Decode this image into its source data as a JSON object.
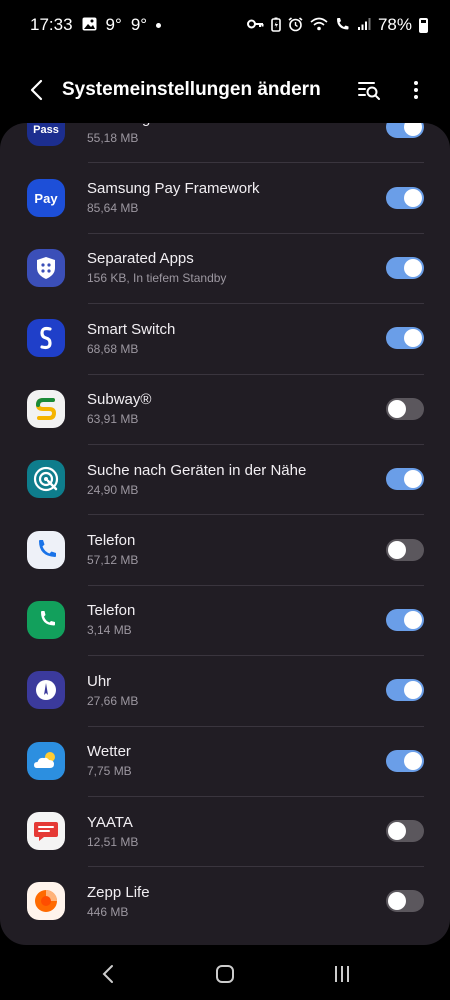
{
  "status_bar": {
    "time": "17:33",
    "temp1": "9°",
    "temp2": "9°",
    "battery": "78%"
  },
  "header": {
    "title": "Systemeinstellungen ändern"
  },
  "apps": [
    {
      "name": "Samsung Pass",
      "size": "55,18 MB",
      "enabled": true,
      "icon": "samsung-pass-icon",
      "color": "#1c2e8f",
      "icon_label": "Pass"
    },
    {
      "name": "Samsung Pay Framework",
      "size": "85,64 MB",
      "enabled": true,
      "icon": "samsung-pay-icon",
      "color": "#1d4fd8",
      "icon_label": "Pay"
    },
    {
      "name": "Separated Apps",
      "size": "156 KB, In tiefem Standby",
      "enabled": true,
      "icon": "separated-apps-icon",
      "color": "#3b4fb8"
    },
    {
      "name": "Smart Switch",
      "size": "68,68 MB",
      "enabled": true,
      "icon": "smart-switch-icon",
      "color": "#1f3fc9"
    },
    {
      "name": "Subway®",
      "size": "63,91 MB",
      "enabled": false,
      "icon": "subway-icon",
      "color": "#f2f2f2"
    },
    {
      "name": "Suche nach Geräten in der Nähe",
      "size": "24,90 MB",
      "enabled": true,
      "icon": "nearby-devices-icon",
      "color": "#0e7d8c"
    },
    {
      "name": "Telefon",
      "size": "57,12 MB",
      "enabled": false,
      "icon": "phone-icon-google",
      "color": "#eef1f8"
    },
    {
      "name": "Telefon",
      "size": "3,14 MB",
      "enabled": true,
      "icon": "phone-icon-samsung",
      "color": "#12a05c"
    },
    {
      "name": "Uhr",
      "size": "27,66 MB",
      "enabled": true,
      "icon": "clock-icon",
      "color": "#3b3a9c"
    },
    {
      "name": "Wetter",
      "size": "7,75 MB",
      "enabled": true,
      "icon": "weather-icon",
      "color": "#2c8fe0"
    },
    {
      "name": "YAATA",
      "size": "12,51 MB",
      "enabled": false,
      "icon": "yaata-icon",
      "color": "#f4f4f4"
    },
    {
      "name": "Zepp Life",
      "size": "446 MB",
      "enabled": false,
      "icon": "zepp-life-icon",
      "color": "#fff4ec"
    }
  ]
}
